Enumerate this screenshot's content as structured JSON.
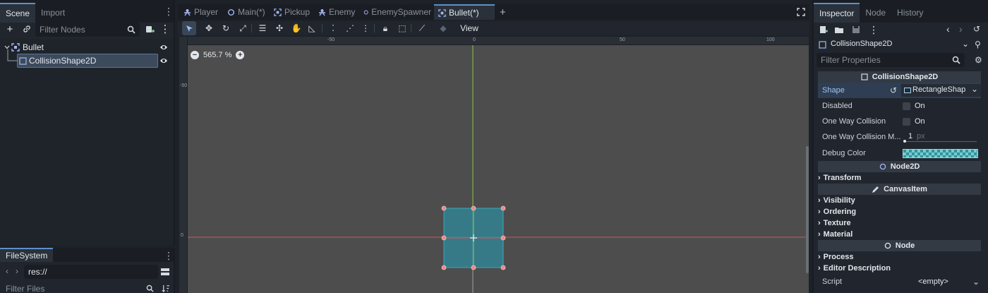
{
  "scene_dock": {
    "tabs": [
      "Scene",
      "Import"
    ],
    "filter_placeholder": "Filter Nodes",
    "nodes": [
      {
        "label": "Bullet",
        "type_icon": "area2d-icon",
        "visible": true
      },
      {
        "label": "CollisionShape2D",
        "type_icon": "collision-shape-icon",
        "visible": true,
        "selected": true
      }
    ]
  },
  "filesystem_dock": {
    "tab": "FileSystem",
    "path": "res://",
    "filter_placeholder": "Filter Files"
  },
  "scene_tabs": [
    {
      "label": "Player",
      "icon": "character-icon",
      "active": false
    },
    {
      "label": "Main(*)",
      "icon": "node-circle-icon",
      "active": false
    },
    {
      "label": "Pickup",
      "icon": "area2d-icon",
      "active": false
    },
    {
      "label": "Enemy",
      "icon": "character-icon",
      "active": false
    },
    {
      "label": "EnemySpawner",
      "icon": "node-circle-icon",
      "active": false
    },
    {
      "label": "Bullet(*)",
      "icon": "area2d-icon",
      "active": true
    }
  ],
  "editor_toolbar": {
    "view_menu": "View"
  },
  "viewport": {
    "zoom_label": "565.7 %",
    "ruler_top": [
      "-50",
      "0",
      "50",
      "100"
    ],
    "ruler_left": [
      "-50",
      "0"
    ]
  },
  "inspector": {
    "tabs": [
      "Inspector",
      "Node",
      "History"
    ],
    "object_name": "CollisionShape2D",
    "filter_placeholder": "Filter Properties",
    "class_header": "CollisionShape2D",
    "props": {
      "shape_label": "Shape",
      "shape_value": "RectangleShap",
      "disabled_label": "Disabled",
      "disabled_value": "On",
      "one_way_label": "One Way Collision",
      "one_way_value": "On",
      "one_way_margin_label": "One Way Collision M...",
      "one_way_margin_value": "1",
      "one_way_margin_unit": "px",
      "debug_color_label": "Debug Color"
    },
    "sections": {
      "node2d": "Node2D",
      "transform": "Transform",
      "canvas_item": "CanvasItem",
      "visibility": "Visibility",
      "ordering": "Ordering",
      "texture": "Texture",
      "material": "Material",
      "node": "Node",
      "process": "Process",
      "editor_description": "Editor Description",
      "script_label": "Script",
      "script_value": "<empty>"
    }
  },
  "colors": {
    "accent": "#5d8fc9",
    "shape_fill": "#2f8a9c",
    "shape_handle": "#e88a88",
    "y_axis": "#8bc34a",
    "x_axis": "#d9534f",
    "debug_color": "#6fcfd2"
  }
}
